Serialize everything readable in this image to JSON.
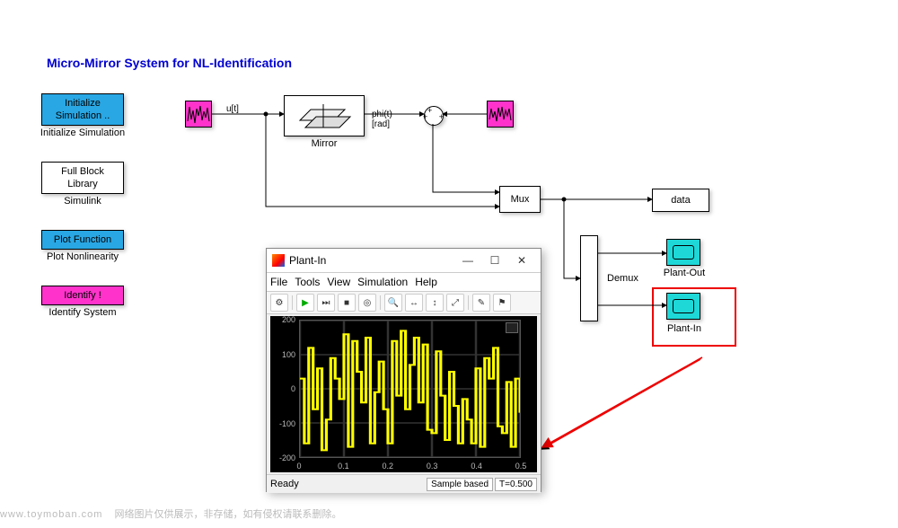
{
  "title": "Micro-Mirror System for NL-Identification",
  "blocks": {
    "init": {
      "label": "Initialize\nSimulation ..",
      "caption": "Initialize Simulation"
    },
    "lib": {
      "label": "Full Block\nLibrary",
      "caption": "Simulink"
    },
    "plot": {
      "label": "Plot Function",
      "caption": "Plot Nonlinearity"
    },
    "ident": {
      "label": "Identify !",
      "caption": "Identify System"
    },
    "mirror": {
      "caption": "Mirror"
    },
    "mux": {
      "label": "Mux"
    },
    "demux": {
      "label": "Demux"
    },
    "data": {
      "label": "data"
    },
    "plantout": {
      "caption": "Plant-Out"
    },
    "plantin": {
      "caption": "Plant-In"
    }
  },
  "signals": {
    "u": "u[t]",
    "phi": "phi(t)\n[rad]"
  },
  "scope": {
    "title": "Plant-In",
    "menu": [
      "File",
      "Tools",
      "View",
      "Simulation",
      "Help"
    ],
    "status": {
      "ready": "Ready",
      "mode": "Sample based",
      "time": "T=0.500"
    }
  },
  "chart_data": {
    "type": "line",
    "title": "Plant-In",
    "xlabel": "",
    "ylabel": "",
    "xlim": [
      0,
      0.5
    ],
    "ylim": [
      -200,
      200
    ],
    "xticks": [
      0,
      0.1,
      0.2,
      0.3,
      0.4,
      0.5
    ],
    "yticks": [
      -200,
      -100,
      0,
      100,
      200
    ],
    "series": [
      {
        "name": "u[t]",
        "x": [
          0,
          0.01,
          0.02,
          0.03,
          0.04,
          0.05,
          0.06,
          0.07,
          0.08,
          0.09,
          0.1,
          0.11,
          0.12,
          0.13,
          0.14,
          0.15,
          0.16,
          0.17,
          0.18,
          0.19,
          0.2,
          0.21,
          0.22,
          0.23,
          0.24,
          0.25,
          0.26,
          0.27,
          0.28,
          0.29,
          0.3,
          0.31,
          0.32,
          0.33,
          0.34,
          0.35,
          0.36,
          0.37,
          0.38,
          0.39,
          0.4,
          0.41,
          0.42,
          0.43,
          0.44,
          0.45,
          0.46,
          0.47,
          0.48,
          0.49,
          0.5
        ],
        "y": [
          30,
          -160,
          120,
          -60,
          60,
          -180,
          -90,
          90,
          30,
          -30,
          160,
          -170,
          140,
          50,
          -40,
          150,
          -160,
          -10,
          80,
          -60,
          -160,
          140,
          -20,
          170,
          -60,
          70,
          150,
          -40,
          130,
          -120,
          -130,
          110,
          -20,
          -150,
          50,
          -50,
          -160,
          -30,
          -90,
          -160,
          60,
          -170,
          90,
          30,
          120,
          -110,
          -130,
          20,
          -170,
          30,
          -70
        ]
      }
    ]
  },
  "footer": {
    "wm": "www.toymoban.com",
    "note": "网络图片仅供展示，非存储，如有侵权请联系删除。"
  }
}
